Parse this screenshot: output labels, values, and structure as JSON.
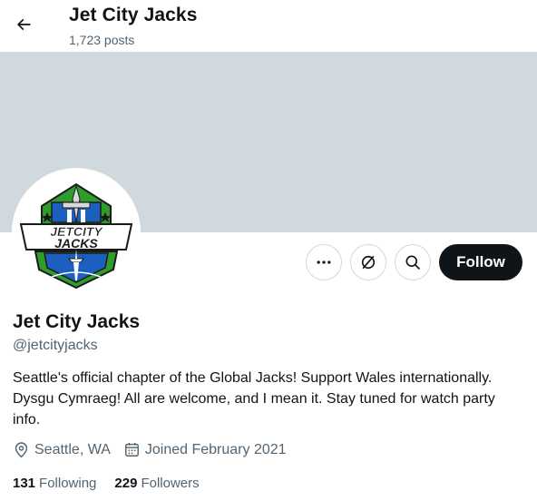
{
  "header": {
    "title": "Jet City Jacks",
    "posts_count": "1,723 posts"
  },
  "logo": {
    "line1": "JETCITY",
    "line2": "JACKS"
  },
  "actions": {
    "more_icon": "more-horizontal-icon",
    "subscribe_icon": "subscribe-icon",
    "search_icon": "search-icon",
    "follow_label": "Follow"
  },
  "profile": {
    "name": "Jet City Jacks",
    "handle": "@jetcityjacks",
    "bio": "Seattle's official chapter of the Global Jacks! Support Wales internationally. Dysgu Cymraeg! All are welcome, and I mean it. Stay tuned for watch party info.",
    "location": "Seattle, WA",
    "joined": "Joined February 2021"
  },
  "stats": {
    "following_count": "131",
    "following_label": "Following",
    "followers_count": "229",
    "followers_label": "Followers"
  },
  "colors": {
    "banner": "#cfd9de",
    "follow_button": "#0f1419",
    "secondary_text": "#536471",
    "logo_green": "#2e9d2c",
    "logo_blue": "#1d5fbf"
  }
}
